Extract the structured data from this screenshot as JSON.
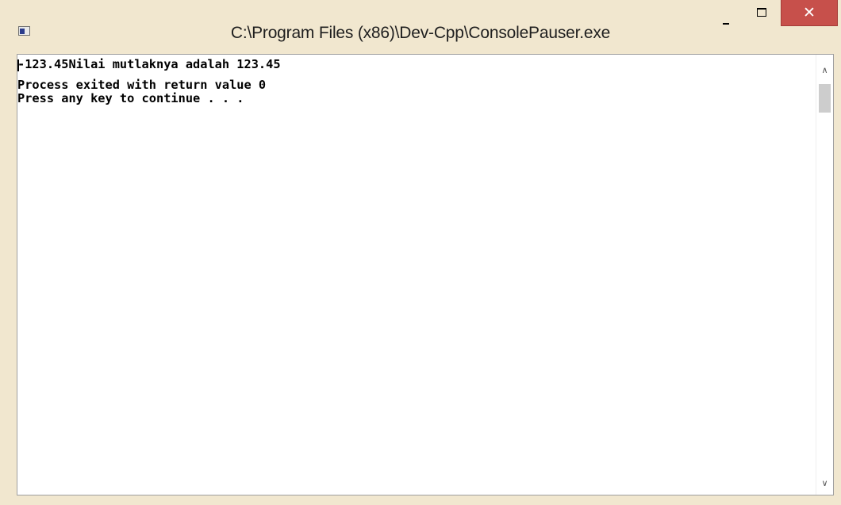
{
  "window": {
    "title": "C:\\Program Files (x86)\\Dev-Cpp\\ConsolePauser.exe",
    "app_icon": "console-app-icon",
    "controls": {
      "minimize_icon": "minimize-icon",
      "maximize_icon": "maximize-icon",
      "close_icon": "close-icon",
      "close_glyph": "✕"
    },
    "close_button_color": "#C7504B",
    "frame_color": "#F1E7CF"
  },
  "console": {
    "lines": [
      "-123.45Nilai mutlaknya adalah 123.45",
      "------------------------------",
      "Process exited with return value 0",
      "Press any key to continue . . ."
    ],
    "text_color": "#000000",
    "background_color": "#FFFFFF"
  },
  "scrollbar": {
    "up_glyph": "∧",
    "down_glyph": "∨",
    "up_icon": "chevron-up-icon",
    "down_icon": "chevron-down-icon"
  }
}
